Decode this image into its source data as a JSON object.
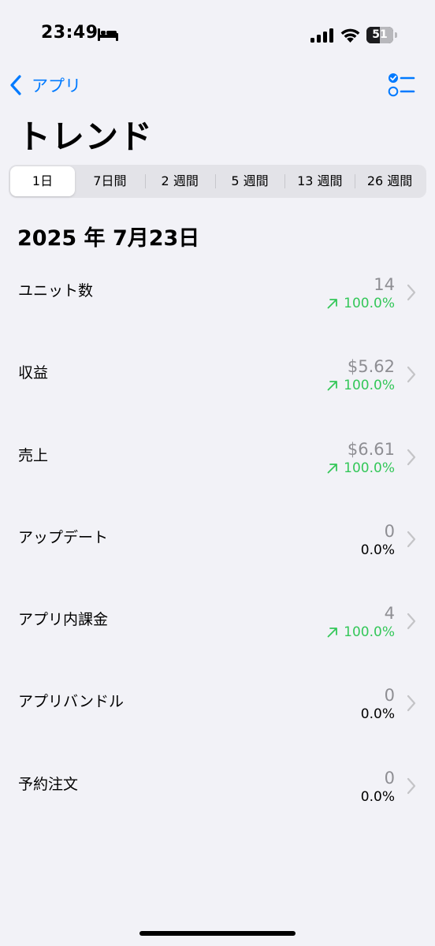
{
  "status_bar": {
    "time": "23:49",
    "battery_level": "51",
    "battery_fraction": 0.51
  },
  "nav": {
    "back_label": "アプリ",
    "back_icon": "chevron-left-icon",
    "filter_icon": "checklist-filter-icon",
    "accent_color": "#007aff"
  },
  "title": "トレンド",
  "periods": [
    {
      "label": "1日",
      "selected": true
    },
    {
      "label": "7日間",
      "selected": false
    },
    {
      "label": "2 週間",
      "selected": false
    },
    {
      "label": "5 週間",
      "selected": false
    },
    {
      "label": "13 週間",
      "selected": false
    },
    {
      "label": "26 週間",
      "selected": false
    }
  ],
  "date": "2025 年 7月23日",
  "metrics": [
    {
      "label": "ユニット数",
      "value": "14",
      "change": "100.0%",
      "trend": "up"
    },
    {
      "label": "収益",
      "value": "$5.62",
      "change": "100.0%",
      "trend": "up"
    },
    {
      "label": "売上",
      "value": "$6.61",
      "change": "100.0%",
      "trend": "up"
    },
    {
      "label": "アップデート",
      "value": "0",
      "change": "0.0%",
      "trend": "none"
    },
    {
      "label": "アプリ内課金",
      "value": "4",
      "change": "100.0%",
      "trend": "up"
    },
    {
      "label": "アプリバンドル",
      "value": "0",
      "change": "0.0%",
      "trend": "none"
    },
    {
      "label": "予約注文",
      "value": "0",
      "change": "0.0%",
      "trend": "none"
    }
  ],
  "colors": {
    "positive": "#34c759",
    "background": "#f2f2f7",
    "secondary_text": "#8e8e93"
  }
}
